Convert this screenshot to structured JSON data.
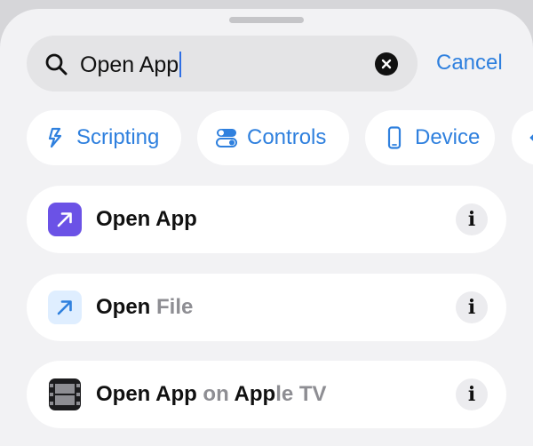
{
  "search": {
    "query": "Open App",
    "cancel_label": "Cancel",
    "search_icon": "magnifying-glass",
    "clear_icon": "xmark-circle-fill"
  },
  "categories": [
    {
      "label": "Scripting",
      "icon": "scripting-icon"
    },
    {
      "label": "Controls",
      "icon": "toggles-icon"
    },
    {
      "label": "Device",
      "icon": "phone-icon"
    },
    {
      "label": "",
      "icon": "arrow-icon"
    }
  ],
  "results": [
    {
      "match": "Open App",
      "rest": "",
      "icon": "arrow-up-right-icon",
      "icon_bg": "#6b52e6",
      "info": "i"
    },
    {
      "match": "Open",
      "rest": " File",
      "icon": "arrow-up-right-icon",
      "icon_bg": "#dfeeff",
      "info": "i"
    },
    {
      "match": "Open App",
      "mid": " on ",
      "match2": "App",
      "rest": "le TV",
      "icon": "film-strip-icon",
      "info": "i"
    }
  ],
  "colors": {
    "accent": "#2f80de",
    "caret": "#2f6fe4",
    "open_app_icon": "#6b52e6"
  }
}
